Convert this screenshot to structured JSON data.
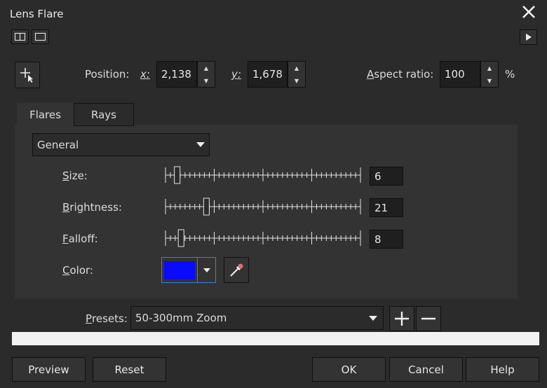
{
  "window": {
    "title": "Lens Flare",
    "close_icon": "close-icon"
  },
  "position": {
    "label": "Position:",
    "x_label": "x:",
    "x_value": "2,138",
    "y_label": "y:",
    "y_value": "1,678"
  },
  "aspect": {
    "label": "Aspect ratio:",
    "value": "100",
    "unit": "%"
  },
  "tabs": [
    {
      "label": "Flares"
    },
    {
      "label": "Rays"
    }
  ],
  "category": {
    "selected": "General"
  },
  "sliders": [
    {
      "label": "Size:",
      "value": "6",
      "level": 0.06
    },
    {
      "label": "Brightness:",
      "value": "21",
      "level": 0.21
    },
    {
      "label": "Falloff:",
      "value": "8",
      "level": 0.08
    }
  ],
  "color": {
    "label": "Color:",
    "swatch": "#0a0aff"
  },
  "presets": {
    "label": "Presets:",
    "selected": "50-300mm Zoom"
  },
  "buttons": {
    "preview": "Preview",
    "reset": "Reset",
    "ok": "OK",
    "cancel": "Cancel",
    "help": "Help"
  },
  "colors": {
    "accent": "#3a7fd5",
    "background": "#2b2b2b",
    "panel": "#333333"
  }
}
